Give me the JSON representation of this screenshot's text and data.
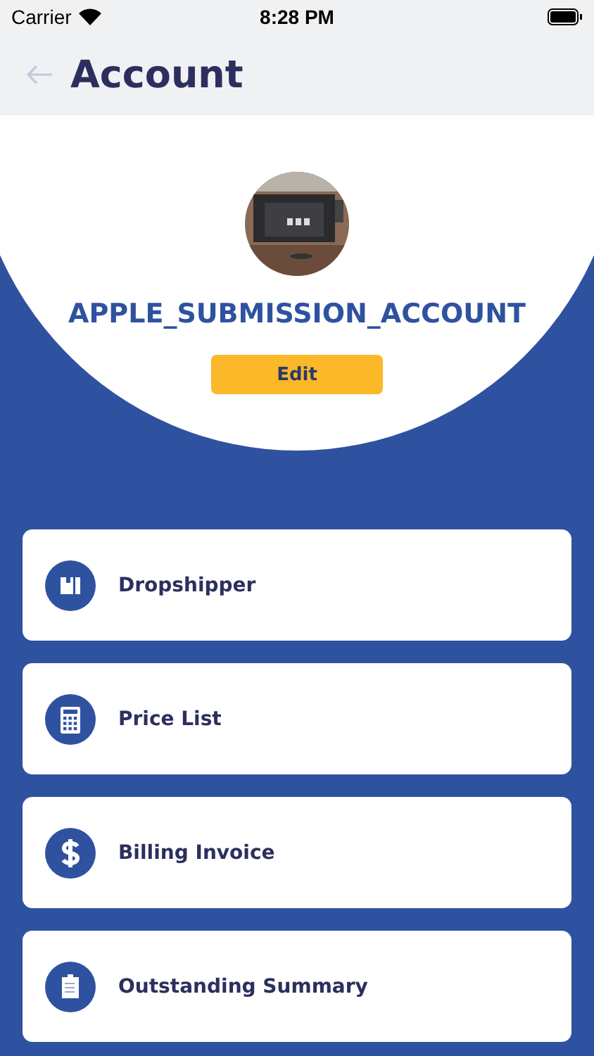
{
  "status_bar": {
    "carrier": "Carrier",
    "time": "8:28 PM"
  },
  "header": {
    "title": "Account"
  },
  "profile": {
    "name": "APPLE_SUBMISSION_ACCOUNT",
    "edit_label": "Edit"
  },
  "menu": [
    {
      "kind": "box",
      "label": "Dropshipper"
    },
    {
      "kind": "calculator",
      "label": "Price List"
    },
    {
      "kind": "dollar",
      "label": "Billing Invoice"
    },
    {
      "kind": "clipboard",
      "label": "Outstanding Summary"
    }
  ]
}
